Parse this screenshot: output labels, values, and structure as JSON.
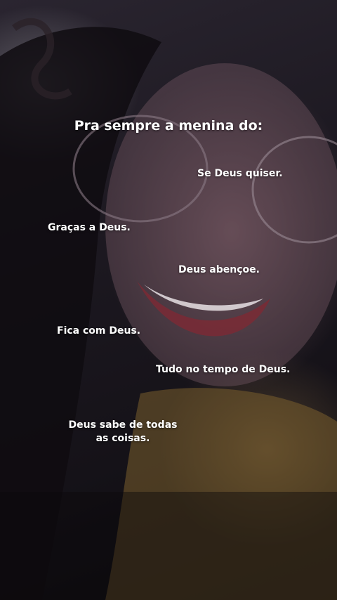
{
  "title": "Pra sempre a menina do:",
  "phrases": [
    "Se Deus quiser.",
    "Graças a Deus.",
    "Deus abençoe.",
    "Fica com Deus.",
    "Tudo no tempo de Deus.",
    "Deus sabe de todas as coisas."
  ],
  "colors": {
    "text": "#ffffff",
    "background": "#151218"
  }
}
